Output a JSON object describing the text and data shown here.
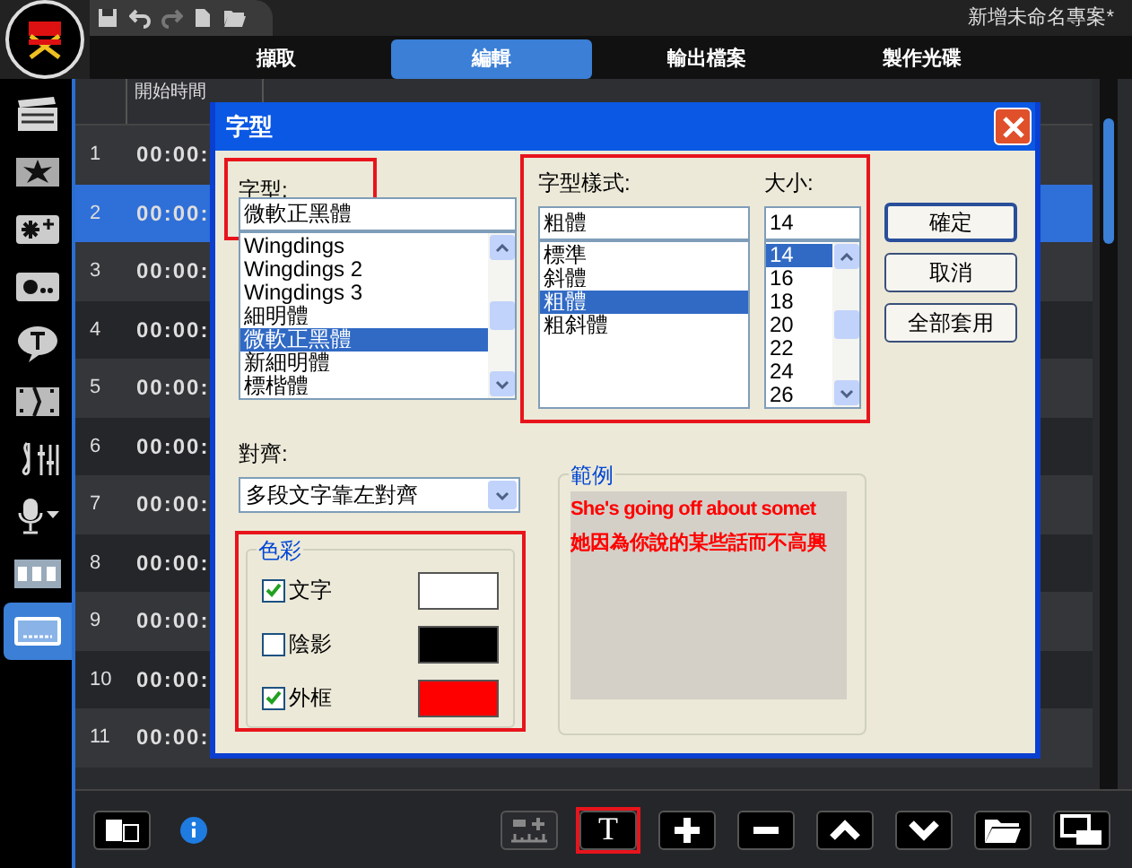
{
  "app": {
    "project_title": "新增未命名專案*"
  },
  "tabs": [
    {
      "label": "擷取",
      "selected": false
    },
    {
      "label": "編輯",
      "selected": true
    },
    {
      "label": "輸出檔案",
      "selected": false
    },
    {
      "label": "製作光碟",
      "selected": false
    }
  ],
  "sidebar": {
    "items": [
      {
        "kind": "film",
        "selected": false
      },
      {
        "kind": "effect",
        "selected": false
      },
      {
        "kind": "sparkle",
        "selected": false
      },
      {
        "kind": "dots",
        "selected": false
      },
      {
        "kind": "title",
        "selected": false
      },
      {
        "kind": "transition",
        "selected": false
      },
      {
        "kind": "music",
        "selected": false
      },
      {
        "kind": "voice",
        "selected": false
      },
      {
        "kind": "numbers",
        "selected": false
      },
      {
        "kind": "subtitle",
        "selected": true
      }
    ]
  },
  "table": {
    "columns": [
      "開始時間"
    ],
    "rows": [
      {
        "index": "1",
        "start": "00:00:",
        "selected": false
      },
      {
        "index": "2",
        "start": "00:00:",
        "selected": true
      },
      {
        "index": "3",
        "start": "00:00:",
        "selected": false
      },
      {
        "index": "4",
        "start": "00:00:",
        "selected": false
      },
      {
        "index": "5",
        "start": "00:00:",
        "selected": false
      },
      {
        "index": "6",
        "start": "00:00:",
        "selected": false
      },
      {
        "index": "7",
        "start": "00:00:",
        "selected": false
      },
      {
        "index": "8",
        "start": "00:00:",
        "selected": false
      },
      {
        "index": "9",
        "start": "00:00:",
        "selected": false
      },
      {
        "index": "10",
        "start": "00:00:",
        "selected": false
      },
      {
        "index": "11",
        "start": "00:00:",
        "selected": false
      }
    ]
  },
  "dialog": {
    "title": "字型",
    "font": {
      "label": "字型:",
      "value": "微軟正黑體",
      "highlighted": true,
      "options": [
        {
          "label": "Wingdings",
          "selected": false
        },
        {
          "label": "Wingdings 2",
          "selected": false
        },
        {
          "label": "Wingdings 3",
          "selected": false
        },
        {
          "label": "細明體",
          "selected": false
        },
        {
          "label": "微軟正黑體",
          "selected": true
        },
        {
          "label": "新細明體",
          "selected": false
        },
        {
          "label": "標楷體",
          "selected": false
        }
      ]
    },
    "style": {
      "label": "字型樣式:",
      "value": "粗體",
      "highlighted": true,
      "options": [
        {
          "label": "標準",
          "selected": false
        },
        {
          "label": "斜體",
          "selected": false
        },
        {
          "label": "粗體",
          "selected": true
        },
        {
          "label": "粗斜體",
          "selected": false
        }
      ]
    },
    "size": {
      "label": "大小:",
      "value": "14",
      "options": [
        {
          "label": "14",
          "selected": true
        },
        {
          "label": "16",
          "selected": false
        },
        {
          "label": "18",
          "selected": false
        },
        {
          "label": "20",
          "selected": false
        },
        {
          "label": "22",
          "selected": false
        },
        {
          "label": "24",
          "selected": false
        },
        {
          "label": "26",
          "selected": false
        }
      ]
    },
    "buttons": [
      "確定",
      "取消",
      "全部套用"
    ],
    "alignment": {
      "label": "對齊:",
      "value": "多段文字靠左對齊"
    },
    "colors": {
      "title": "色彩",
      "highlighted": true,
      "items": [
        {
          "label": "文字",
          "checked": true,
          "color": "#ffffff"
        },
        {
          "label": "陰影",
          "checked": false,
          "color": "#000000"
        },
        {
          "label": "外框",
          "checked": true,
          "color": "#ff0000"
        }
      ]
    },
    "sample": {
      "title": "範例",
      "lines": [
        "She's going off about somet",
        "她因為你說的某些話而不高興"
      ]
    }
  },
  "toolbar": {
    "buttons": [
      {
        "kind": "add-marker",
        "disabled": true,
        "highlighted": false
      },
      {
        "kind": "text",
        "label": "T",
        "disabled": false,
        "highlighted": true
      },
      {
        "kind": "plus",
        "disabled": false,
        "highlighted": false
      },
      {
        "kind": "minus",
        "disabled": false,
        "highlighted": false
      },
      {
        "kind": "up",
        "disabled": false,
        "highlighted": false
      },
      {
        "kind": "down",
        "disabled": false,
        "highlighted": false
      },
      {
        "kind": "folder",
        "disabled": false,
        "highlighted": false
      },
      {
        "kind": "screen",
        "disabled": false,
        "highlighted": false
      }
    ]
  }
}
